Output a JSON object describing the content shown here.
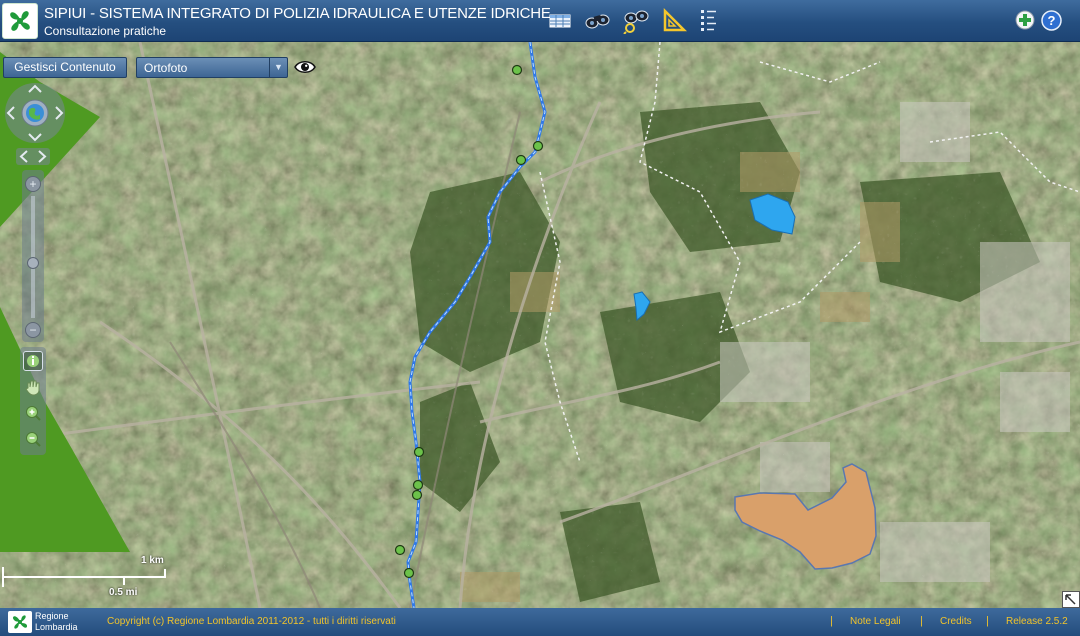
{
  "header": {
    "title": "SIPIUI - SISTEMA INTEGRATO DI POLIZIA IDRAULICA E UTENZE IDRICHE",
    "subtitle": "Consultazione pratiche",
    "toolbar": [
      "table-icon",
      "binoculars-icon",
      "binoculars-search-icon",
      "ruler-icon",
      "list-icon"
    ],
    "right_buttons": [
      "add-icon",
      "help-icon"
    ]
  },
  "map": {
    "content_button_label": "Gestisci Contenuto",
    "base_layer": {
      "selected": "Ortofoto"
    },
    "scale": {
      "km_label": "1 km",
      "mi_label": "0.5 mi"
    },
    "zoom_level": 0.45,
    "colors": {
      "river": "#2f78e8",
      "water_body": "#2ea6ef",
      "area_polygon": "#d9a06a",
      "overlay_green": "#4f9a22",
      "gauge_point": "#6cc24a"
    }
  },
  "footer": {
    "region_line1": "Regione",
    "region_line2": "Lombardia",
    "copyright": "Copyright (c) Regione Lombardia 2011-2012 - tutti i diritti riservati",
    "links": [
      "Note Legali",
      "Credits",
      "Release 2.5.2"
    ]
  }
}
